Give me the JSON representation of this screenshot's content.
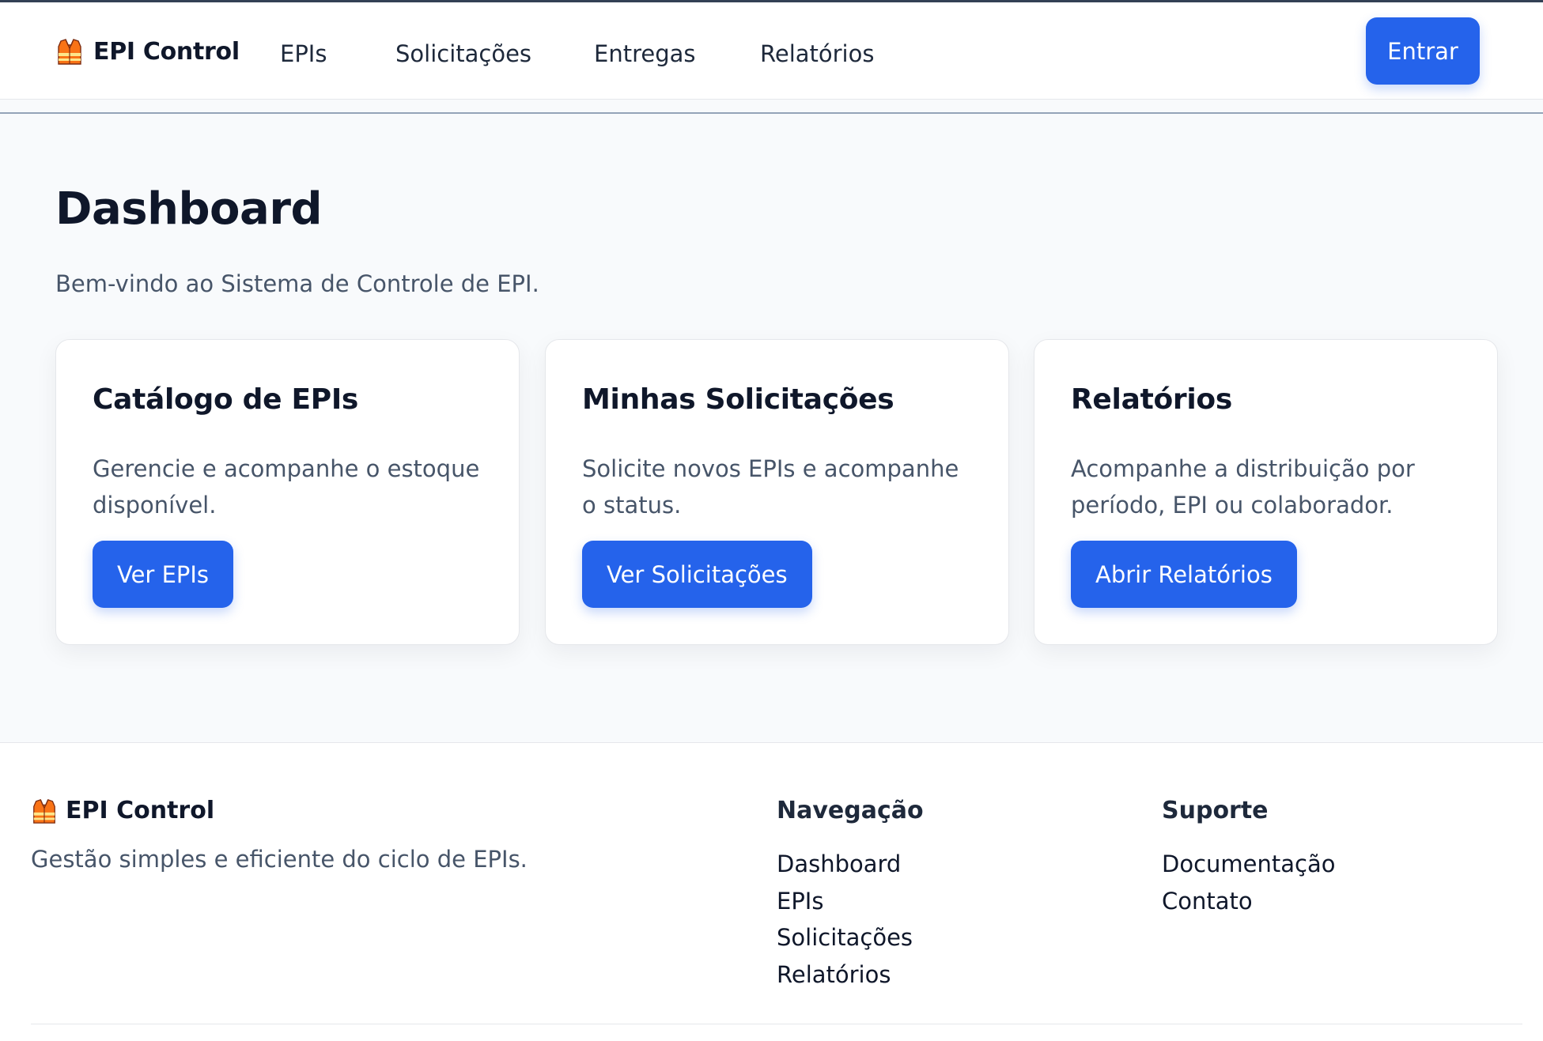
{
  "brand": {
    "name": "EPI Control",
    "logo_icon": "safety-vest-icon"
  },
  "header": {
    "nav": [
      "EPIs",
      "Solicitações",
      "Entregas",
      "Relatórios"
    ],
    "login_label": "Entrar"
  },
  "main": {
    "title": "Dashboard",
    "subtitle": "Bem-vindo ao Sistema de Controle de EPI.",
    "cards": [
      {
        "title": "Catálogo de EPIs",
        "description": "Gerencie e acompanhe o estoque disponível.",
        "button": "Ver EPIs"
      },
      {
        "title": "Minhas Solicitações",
        "description": "Solicite novos EPIs e acompanhe o status.",
        "button": "Ver Solicitações"
      },
      {
        "title": "Relatórios",
        "description": "Acompanhe a distribuição por período, EPI ou colaborador.",
        "button": "Abrir Relatórios"
      }
    ]
  },
  "footer": {
    "brand_name": "EPI Control",
    "tagline": "Gestão simples e eficiente do ciclo de EPIs.",
    "navigation": {
      "title": "Navegação",
      "links": [
        "Dashboard",
        "EPIs",
        "Solicitações",
        "Relatórios"
      ]
    },
    "support": {
      "title": "Suporte",
      "links": [
        "Documentação",
        "Contato"
      ]
    }
  },
  "colors": {
    "primary": "#2563eb",
    "background": "#f8fafc",
    "text": "#0f172a",
    "muted": "#475569",
    "vest_orange": "#f97316"
  }
}
